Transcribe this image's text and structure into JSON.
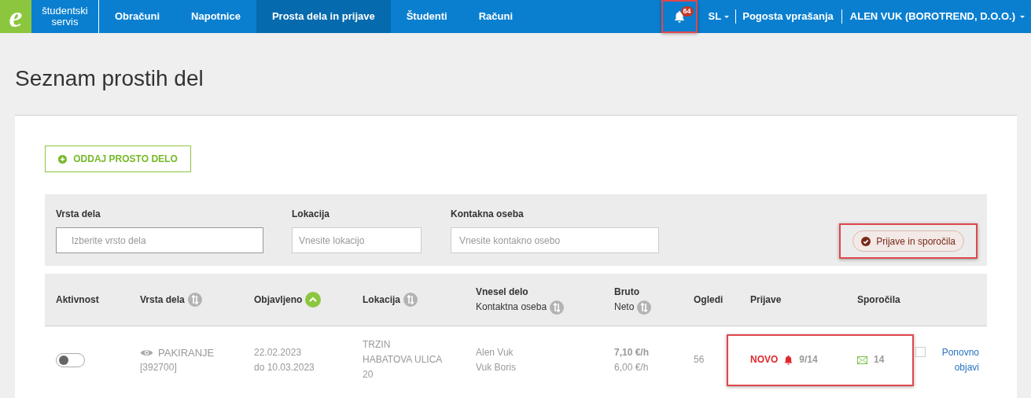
{
  "nav": {
    "logo_letter": "e",
    "logo_text": [
      "študentski",
      "servis"
    ],
    "items": [
      {
        "label": "Obračuni",
        "selected": false
      },
      {
        "label": "Napotnice",
        "selected": false
      },
      {
        "label": "Prosta dela in prijave",
        "selected": true
      },
      {
        "label": "Študenti",
        "selected": false
      },
      {
        "label": "Računi",
        "selected": false
      }
    ],
    "notifications": {
      "count": "64",
      "highlighted": true
    },
    "language": "SL",
    "faq": "Pogosta vprašanja",
    "user": "ALEN VUK (BOROTREND, D.O.O.)"
  },
  "title": "Seznam prostih del",
  "add_button": "ODDAJ PROSTO DELO",
  "filters": {
    "fields": [
      {
        "label": "Vrsta dela",
        "placeholder": "Izberite vrsto dela",
        "kind": "select"
      },
      {
        "label": "Lokacija",
        "placeholder": "Vnesite lokacijo",
        "kind": "text"
      },
      {
        "label": "Kontakna oseba",
        "placeholder": "Vnesite kontakno osebo",
        "kind": "text"
      }
    ],
    "chip": {
      "label": "Prijave in sporočila",
      "checked": true,
      "highlighted": true
    }
  },
  "table": {
    "columns": [
      {
        "label": "Aktivnost",
        "kind": "plain"
      },
      {
        "label": "Vrsta dela",
        "kind": "sortable"
      },
      {
        "label": "Objavljeno",
        "kind": "sorted"
      },
      {
        "label": "Lokacija",
        "kind": "sortable"
      },
      {
        "label": "Vnesel delo",
        "sublabel": "Kontaktna oseba",
        "kind": "sortable"
      },
      {
        "label": "Bruto",
        "sublabel": "Neto",
        "kind": "sortable"
      },
      {
        "label": "Ogledi",
        "kind": "plain"
      },
      {
        "label": "Prijave",
        "kind": "plain"
      },
      {
        "label": "Sporočila",
        "kind": "plain"
      }
    ],
    "rows": [
      {
        "active": false,
        "job": "PAKIRANJE",
        "job_id": "[392700]",
        "published": [
          "22.02.2023",
          "do 10.03.2023"
        ],
        "location": [
          "TRZIN",
          "HABATOVA ULICA",
          "20"
        ],
        "entered_by": "Alen Vuk",
        "contact": "Vuk Boris",
        "gross": "7,10 €/h",
        "net": "6,00 €/h",
        "views": "56",
        "new_label": "NOVO",
        "applications": "9/14",
        "messages": "14",
        "highlighted": true,
        "repost_checked": false,
        "repost": "Ponovno objavi"
      }
    ]
  }
}
